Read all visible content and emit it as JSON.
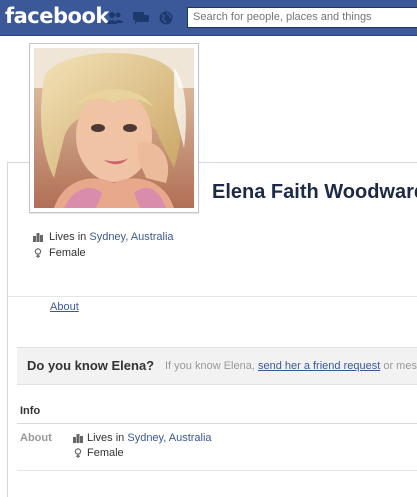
{
  "topbar": {
    "logo": "facebook",
    "search_placeholder": "Search for people, places and things",
    "jewels": [
      "friend-requests-icon",
      "messages-icon",
      "notifications-icon"
    ],
    "brand_color": "#3b5998"
  },
  "profile": {
    "name": "Elena Faith Woodward",
    "photo": "profile-photo",
    "facts": {
      "lives_prefix": "Lives in",
      "city": "Sydney, Australia",
      "gender": "Female"
    }
  },
  "tabs": {
    "about": "About"
  },
  "know_box": {
    "title": "Do you know Elena?",
    "text_prefix": "If you know Elena,",
    "link": "send her a friend request",
    "text_suffix": "or mes"
  },
  "info": {
    "title": "Info",
    "label": "About",
    "lives_prefix": "Lives in",
    "city": "Sydney, Australia",
    "gender": "Female"
  }
}
